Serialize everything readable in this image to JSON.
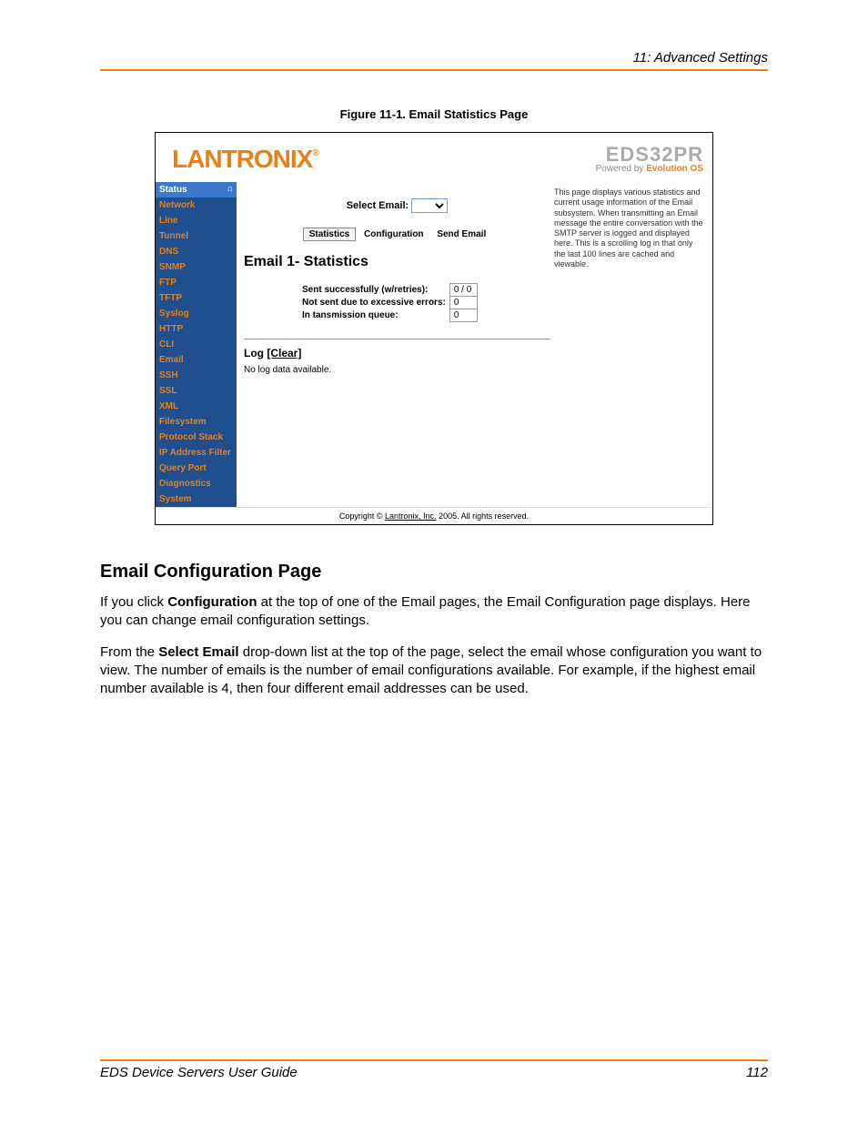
{
  "header": {
    "chapter": "11: Advanced Settings"
  },
  "figure": {
    "caption": "Figure 11-1. Email Statistics Page"
  },
  "screenshot": {
    "logo_text": "LANTRONIX",
    "model": "EDS32PR",
    "powered_prefix": "Powered by ",
    "powered_brand": "Evolution OS",
    "sidebar": [
      "Status",
      "Network",
      "Line",
      "Tunnel",
      "DNS",
      "SNMP",
      "FTP",
      "TFTP",
      "Syslog",
      "HTTP",
      "CLI",
      "Email",
      "SSH",
      "SSL",
      "XML",
      "Filesystem",
      "Protocol Stack",
      "IP Address Filter",
      "Query Port",
      "Diagnostics",
      "System"
    ],
    "select_label": "Select Email:",
    "buttons": {
      "stats": "Statistics",
      "config": "Configuration",
      "send": "Send Email"
    },
    "title": "Email 1- Statistics",
    "rows": [
      {
        "label": "Sent successfully (w/retries):",
        "value": "0 / 0"
      },
      {
        "label": "Not sent due to excessive errors:",
        "value": "0"
      },
      {
        "label": "In tansmission queue:",
        "value": "0"
      }
    ],
    "log_label": "Log ",
    "log_clear": "[Clear]",
    "log_text": "No log data available.",
    "help_text": "This page displays various statistics and current usage information of the Email subsystem. When transmitting an Email message the entire conversation with the SMTP server is logged and displayed here. This is a scrolling log in that only the last 100 lines are cached and viewable.",
    "footer_prefix": "Copyright © ",
    "footer_link": "Lantronix, Inc.",
    "footer_suffix": " 2005. All rights reserved."
  },
  "section": {
    "heading": "Email Configuration Page",
    "p1_a": "If you click ",
    "p1_b": "Configuration",
    "p1_c": " at the top of one of the Email pages, the Email Configuration page displays. Here you can change email configuration settings.",
    "p2_a": "From the ",
    "p2_b": "Select Email",
    "p2_c": " drop-down list at the top of the page, select the email whose configuration you want to view. The number of emails is the number of email configurations available. For example, if the highest email number available is 4, then four different email addresses can be used."
  },
  "footer": {
    "guide": "EDS Device Servers User Guide",
    "page": "112"
  }
}
